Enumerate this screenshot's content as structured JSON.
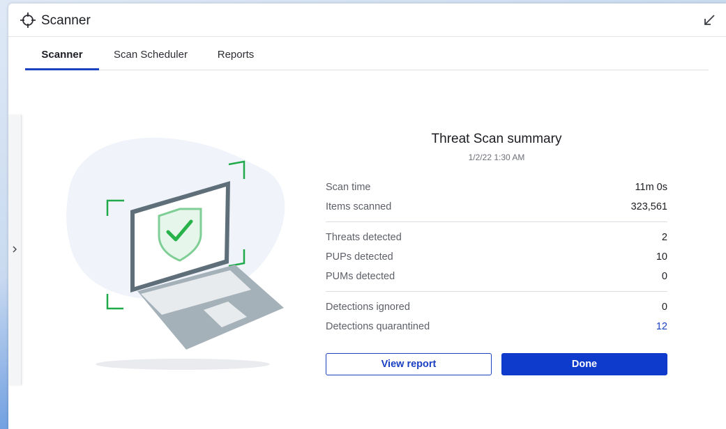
{
  "window": {
    "title": "Scanner"
  },
  "tabs": [
    {
      "label": "Scanner",
      "active": true
    },
    {
      "label": "Scan Scheduler",
      "active": false
    },
    {
      "label": "Reports",
      "active": false
    }
  ],
  "summary": {
    "title": "Threat Scan summary",
    "date": "1/2/22 1:30 AM",
    "groups": [
      [
        {
          "label": "Scan time",
          "value": "11m 0s"
        },
        {
          "label": "Items scanned",
          "value": "323,561"
        }
      ],
      [
        {
          "label": "Threats detected",
          "value": "2"
        },
        {
          "label": "PUPs detected",
          "value": "10"
        },
        {
          "label": "PUMs detected",
          "value": "0"
        }
      ],
      [
        {
          "label": "Detections ignored",
          "value": "0"
        },
        {
          "label": "Detections quarantined",
          "value": "12"
        }
      ]
    ]
  },
  "buttons": {
    "view_report": "View report",
    "done": "Done"
  },
  "colors": {
    "accent": "#1a41c2",
    "primary_button": "#0e3bcc",
    "shield_green": "#27b24a",
    "frame_green": "#1fa94a"
  },
  "icons": {
    "title": "crosshair-icon",
    "collapse": "minimize-arrow-icon",
    "side": "chevron-right-icon"
  }
}
